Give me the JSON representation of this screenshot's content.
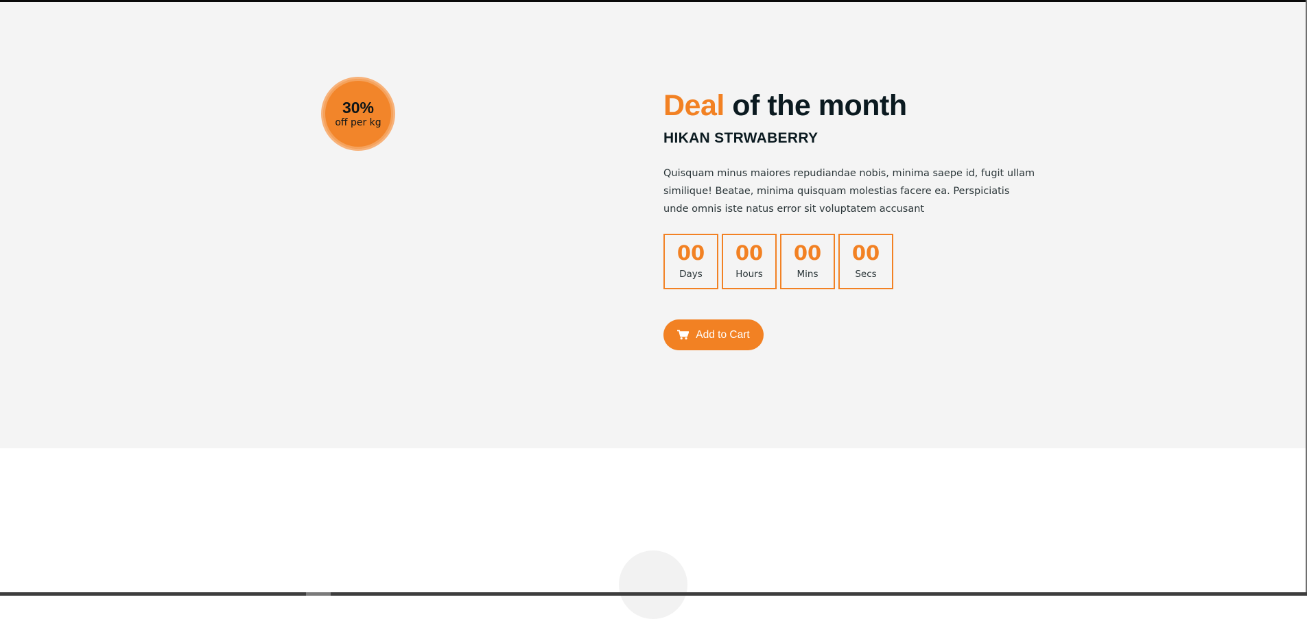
{
  "badge": {
    "percent": "30%",
    "sub": "off per kg"
  },
  "deal": {
    "title_accent": "Deal",
    "title_rest": " of the month",
    "product": "HIKAN STRWABERRY",
    "description": "Quisquam minus maiores repudiandae nobis, minima saepe id, fugit ullam similique! Beatae, minima quisquam molestias facere ea. Perspiciatis unde omnis iste natus error sit voluptatem accusant"
  },
  "countdown": [
    {
      "value": "00",
      "label": "Days"
    },
    {
      "value": "00",
      "label": "Hours"
    },
    {
      "value": "00",
      "label": "Mins"
    },
    {
      "value": "00",
      "label": "Secs"
    }
  ],
  "cart": {
    "label": "Add to Cart",
    "icon": "shopping-cart-icon"
  },
  "colors": {
    "accent": "#f28123",
    "dark_text": "#0b1a20",
    "section_bg": "#f4f4f4"
  }
}
